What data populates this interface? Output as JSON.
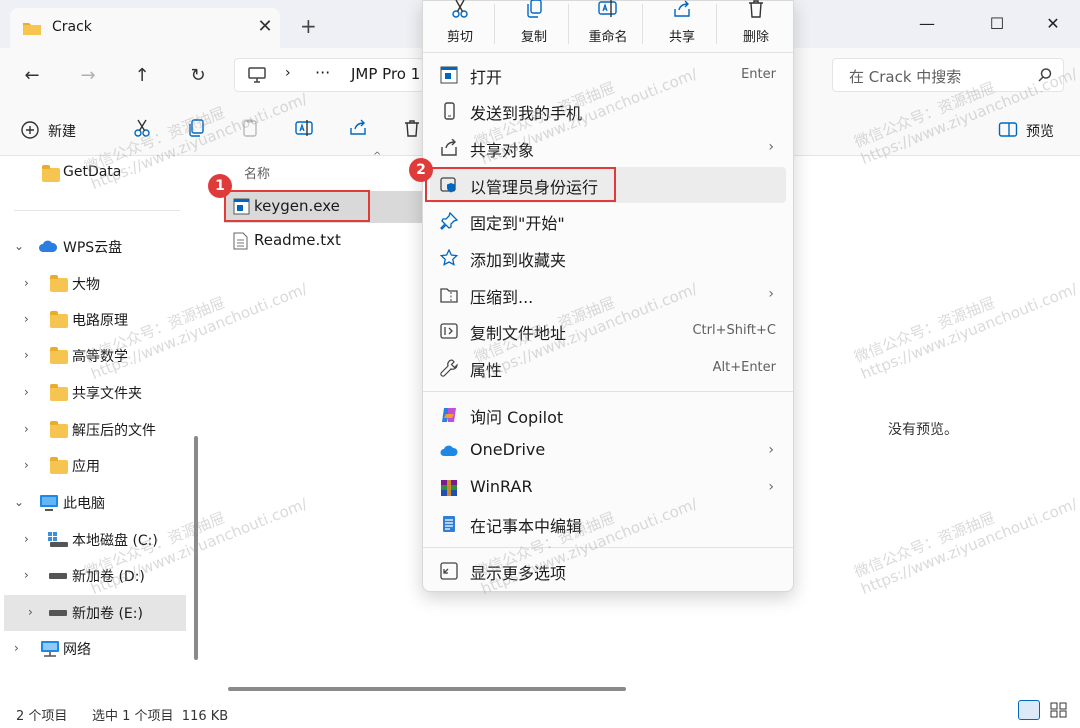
{
  "window": {
    "tab_title": "Crack",
    "new_tab": "+",
    "minimize": "—",
    "maximize": "☐",
    "close": "✕",
    "tab_close": "✕"
  },
  "nav": {
    "address": "JMP Pro 1",
    "more": "···",
    "search_placeholder": "在 Crack 中搜索"
  },
  "toolbar": {
    "new_label": "新建",
    "preview_label": "预览"
  },
  "quick_actions": [
    {
      "label": "剪切",
      "icon": "scissors-icon"
    },
    {
      "label": "复制",
      "icon": "copy-icon"
    },
    {
      "label": "重命名",
      "icon": "rename-icon"
    },
    {
      "label": "共享",
      "icon": "share-icon"
    },
    {
      "label": "删除",
      "icon": "trash-icon"
    }
  ],
  "sidebar": {
    "items": [
      {
        "label": "GetData"
      },
      {
        "label": "WPS云盘"
      },
      {
        "label": "大物"
      },
      {
        "label": "电路原理"
      },
      {
        "label": "高等数学"
      },
      {
        "label": "共享文件夹"
      },
      {
        "label": "解压后的文件"
      },
      {
        "label": "应用"
      },
      {
        "label": "此电脑"
      },
      {
        "label": "本地磁盘 (C:)"
      },
      {
        "label": "新加卷 (D:)"
      },
      {
        "label": "新加卷 (E:)"
      },
      {
        "label": "网络"
      }
    ]
  },
  "files": {
    "column_name": "名称",
    "rows": [
      {
        "name": "keygen.exe"
      },
      {
        "name": "Readme.txt"
      }
    ]
  },
  "annotations": {
    "badge1": "1",
    "badge2": "2"
  },
  "context_menu": {
    "items": [
      {
        "label": "打开",
        "shortcut": "Enter"
      },
      {
        "label": "发送到我的手机"
      },
      {
        "label": "共享对象",
        "arrow": "›"
      },
      {
        "label": "以管理员身份运行"
      },
      {
        "label": "固定到\"开始\""
      },
      {
        "label": "添加到收藏夹"
      },
      {
        "label": "压缩到...",
        "arrow": "›"
      },
      {
        "label": "复制文件地址",
        "shortcut": "Ctrl+Shift+C"
      },
      {
        "label": "属性",
        "shortcut": "Alt+Enter"
      },
      {
        "label": "询问 Copilot"
      },
      {
        "label": "OneDrive",
        "arrow": "›"
      },
      {
        "label": "WinRAR",
        "arrow": "›"
      },
      {
        "label": "在记事本中编辑"
      },
      {
        "label": "显示更多选项"
      }
    ]
  },
  "preview": {
    "empty_text": "没有预览。"
  },
  "status": {
    "count": "2 个项目",
    "selection": "选中 1 个项目  116 KB"
  },
  "watermark": {
    "line1": "微信公众号：资源抽屉",
    "line2": "https://www.ziyuanchouti.com/"
  },
  "colors": {
    "accent": "#0067c0",
    "annotation_red": "#e03b3b",
    "folder": "#f5c451"
  }
}
